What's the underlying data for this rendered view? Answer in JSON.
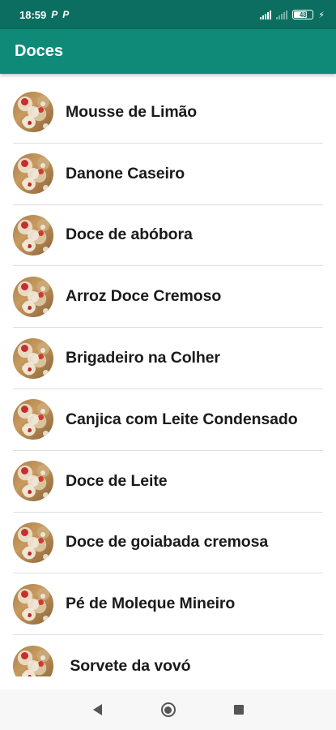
{
  "status_bar": {
    "time": "18:59",
    "notif_1": "P",
    "notif_2": "P",
    "battery_level": "48",
    "icons": [
      "signal-icon",
      "signal-weak-icon",
      "battery-icon",
      "charging-icon"
    ]
  },
  "app_bar": {
    "title": "Doces",
    "color": "#0f8a78"
  },
  "recipes": [
    {
      "label": "Mousse de Limão"
    },
    {
      "label": "Danone Caseiro"
    },
    {
      "label": "Doce de abóbora"
    },
    {
      "label": "Arroz Doce Cremoso"
    },
    {
      "label": "Brigadeiro na Colher"
    },
    {
      "label": "Canjica com Leite Condensado"
    },
    {
      "label": "Doce de Leite"
    },
    {
      "label": "Doce de goiabada cremosa"
    },
    {
      "label": "Pé de Moleque Mineiro"
    },
    {
      "label": " Sorvete da vovó"
    }
  ],
  "nav_bar": {
    "icons": [
      "back-icon",
      "home-icon",
      "recents-icon"
    ]
  }
}
